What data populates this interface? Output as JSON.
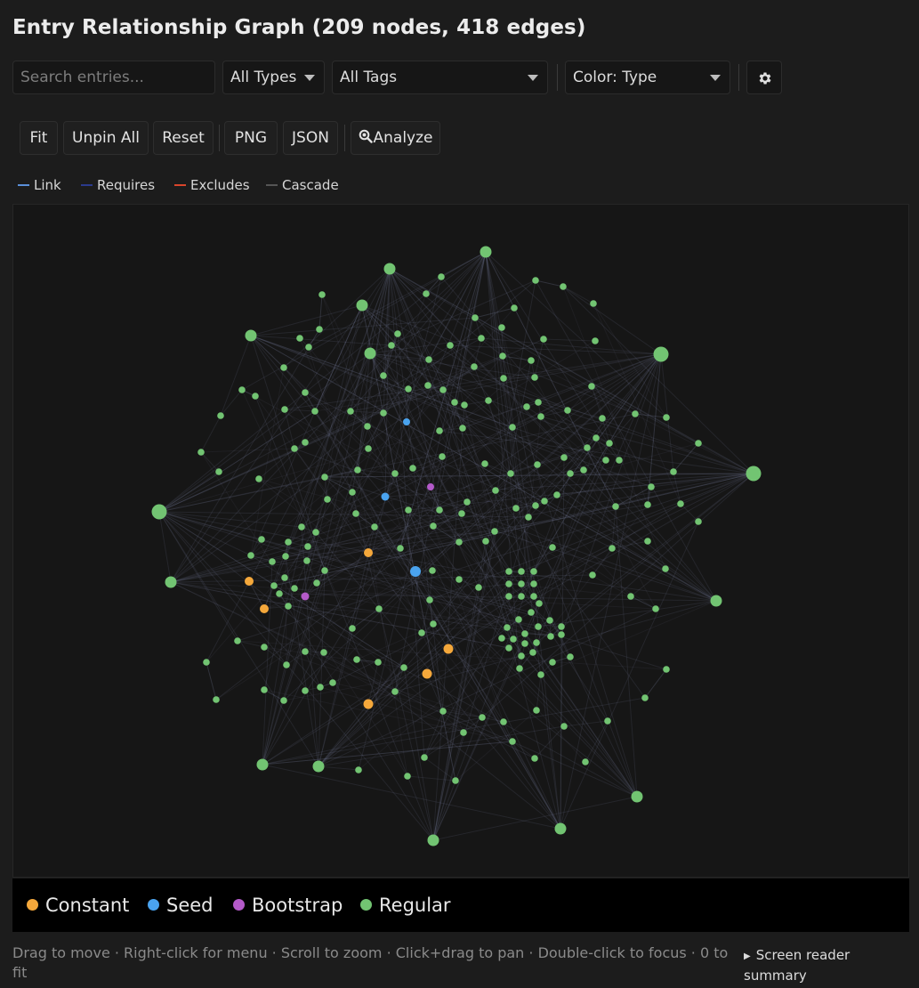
{
  "title": "Entry Relationship Graph (209 nodes, 418 edges)",
  "search": {
    "placeholder": "Search entries..."
  },
  "filters": {
    "types": "All Types",
    "tags": "All Tags",
    "color": "Color: Type"
  },
  "settings_icon": "gear-icon",
  "toolbar": {
    "fit": "Fit",
    "unpin_all": "Unpin All",
    "reset": "Reset",
    "png": "PNG",
    "json": "JSON",
    "analyze": "Analyze",
    "analyze_icon": "magnifier-icon"
  },
  "edge_legend": [
    {
      "label": "Link",
      "color": "#5b8fd9"
    },
    {
      "label": "Requires",
      "color": "#2b3a8c"
    },
    {
      "label": "Excludes",
      "color": "#d9452b"
    },
    {
      "label": "Cascade",
      "color": "#555555"
    }
  ],
  "node_legend": [
    {
      "label": "Constant",
      "color": "#f5a83b"
    },
    {
      "label": "Seed",
      "color": "#4aa3ef"
    },
    {
      "label": "Bootstrap",
      "color": "#b45ac9"
    },
    {
      "label": "Regular",
      "color": "#72c472"
    }
  ],
  "hint": "Drag to move · Right-click for menu · Scroll to zoom · Click+drag to pan · Double-click to focus · 0 to fit",
  "screen_reader": "Screen reader summary"
}
